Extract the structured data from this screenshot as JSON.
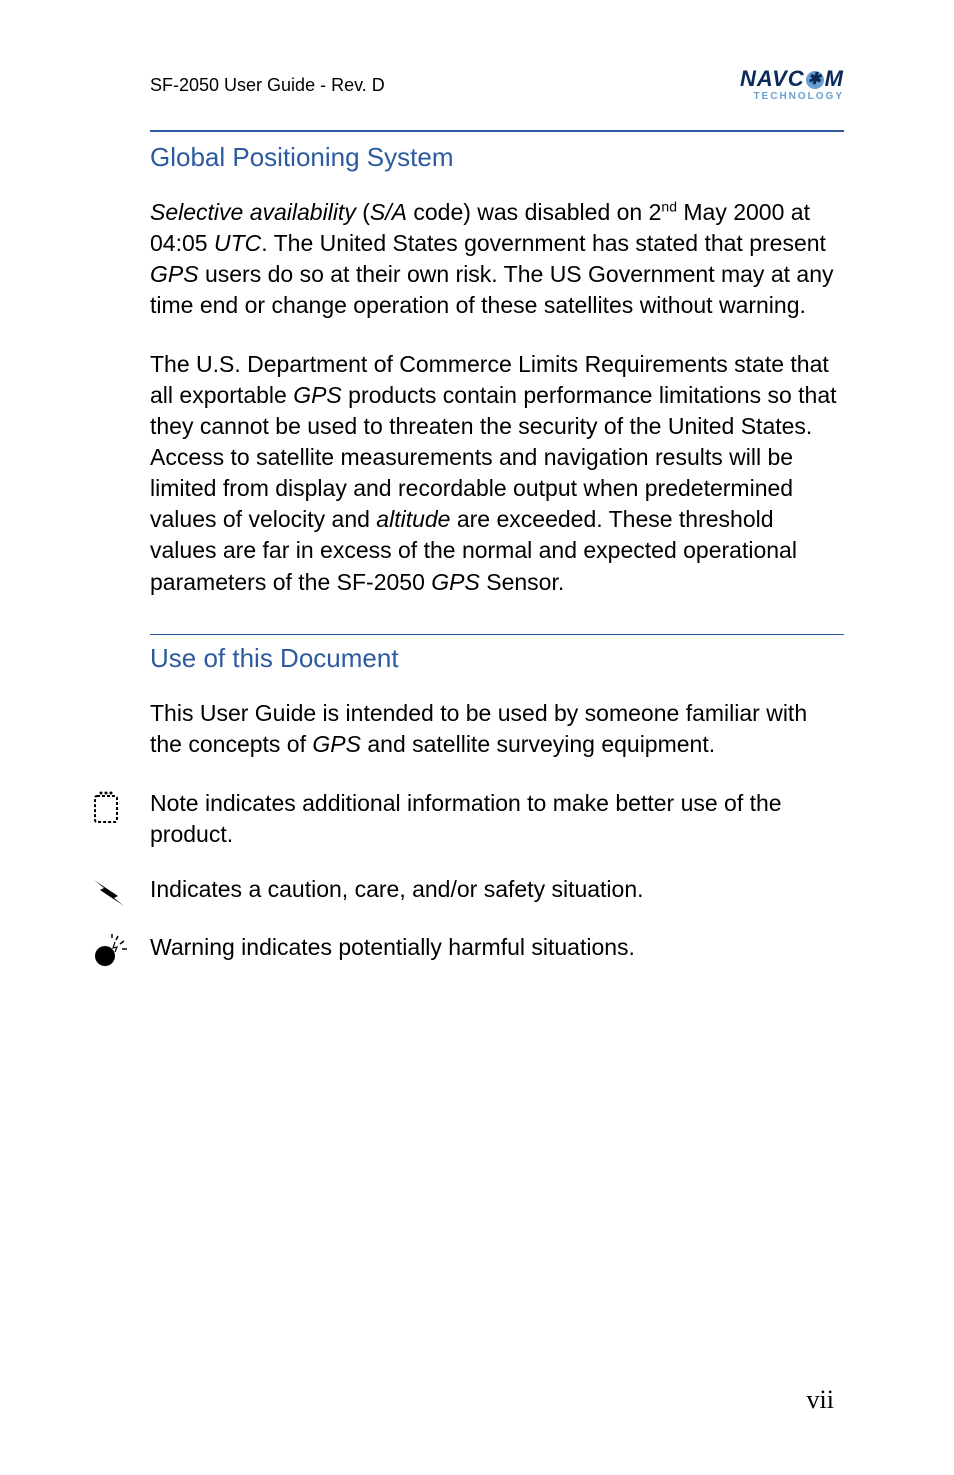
{
  "header": {
    "left": "SF-2050 User Guide - Rev. D",
    "logo_main_pre": "NAVC",
    "logo_main_post": "M",
    "logo_sub": "TECHNOLOGY"
  },
  "section1": {
    "heading": "Global Positioning System",
    "para1": {
      "t1": "Selective availability",
      "t2": " (",
      "t3": "S/A",
      "t4": " code) was disabled on 2",
      "sup": "nd",
      "t5": " May 2000 at 04:05 ",
      "t6": "UTC",
      "t7": ". The United States government has stated that present ",
      "t8": "GPS",
      "t9": " users do so at their own risk. The US Government may at any time end or change operation of these satellites without warning."
    },
    "para2": {
      "t1": "The U.S. Department of Commerce Limits Requirements state that all exportable ",
      "t2": "GPS",
      "t3": " products contain performance limitations so that they cannot be used to threaten the security of the United States. Access to satellite measurements and navigation results will be limited from display and recordable output when predetermined values of velocity and ",
      "t4": "altitude",
      "t5": " are exceeded. These threshold values are far in excess of the normal and expected operational parameters of the SF-2050 ",
      "t6": "GPS",
      "t7": " Sensor."
    }
  },
  "section2": {
    "heading": "Use of this Document",
    "para1": {
      "t1": "This User Guide is intended to be used by someone familiar with the concepts of ",
      "t2": "GPS",
      "t3": " and satellite surveying equipment."
    },
    "note_text": "Note indicates additional information to make better use of the product.",
    "caution_text": "Indicates a caution, care, and/or safety situation.",
    "warning_text": "Warning indicates potentially harmful situations."
  },
  "page_number": "vii"
}
